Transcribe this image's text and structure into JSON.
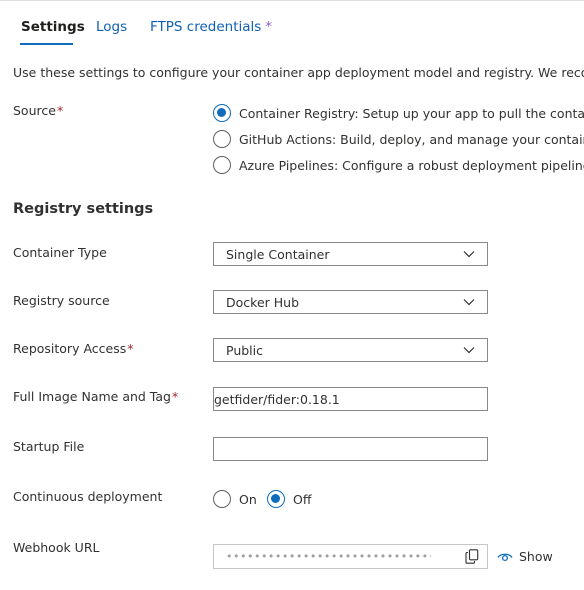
{
  "tabs": [
    {
      "label": "Settings"
    },
    {
      "label": "Logs"
    },
    {
      "label": "FTPS credentials",
      "indicator": "*"
    }
  ],
  "intro_text": "Use these settings to configure your container app deployment model and registry. We recon",
  "source": {
    "label": "Source",
    "required": "*",
    "options": [
      {
        "label": "Container Registry: Setup up your app to pull the contai",
        "selected": true
      },
      {
        "label": "GitHub Actions: Build, deploy, and manage your contain",
        "selected": false
      },
      {
        "label": "Azure Pipelines: Configure a robust deployment pipeline",
        "selected": false
      }
    ]
  },
  "registry_section_title": "Registry settings",
  "fields": {
    "container_type": {
      "label": "Container Type",
      "value": "Single Container"
    },
    "registry_source": {
      "label": "Registry source",
      "value": "Docker Hub"
    },
    "repository_access": {
      "label": "Repository Access",
      "required": "*",
      "value": "Public"
    },
    "image_name": {
      "label": "Full Image Name and Tag",
      "required": "*",
      "value": "getfider/fider:0.18.1"
    },
    "startup_file": {
      "label": "Startup File",
      "value": ""
    }
  },
  "continuous_deployment": {
    "label": "Continuous deployment",
    "on_label": "On",
    "off_label": "Off",
    "selected": "Off"
  },
  "webhook": {
    "label": "Webhook URL",
    "masked_value": "••••••••••••••••••••••••••••••••••••••••••••••••••••...",
    "show_label": "Show"
  },
  "icons": [
    "chevron-down-icon",
    "copy-icon",
    "eye-icon"
  ],
  "colors": {
    "accent": "#0f6cbd",
    "link": "#0f5fb5",
    "required": "#a4262c",
    "indicator": "#8a63d2"
  }
}
